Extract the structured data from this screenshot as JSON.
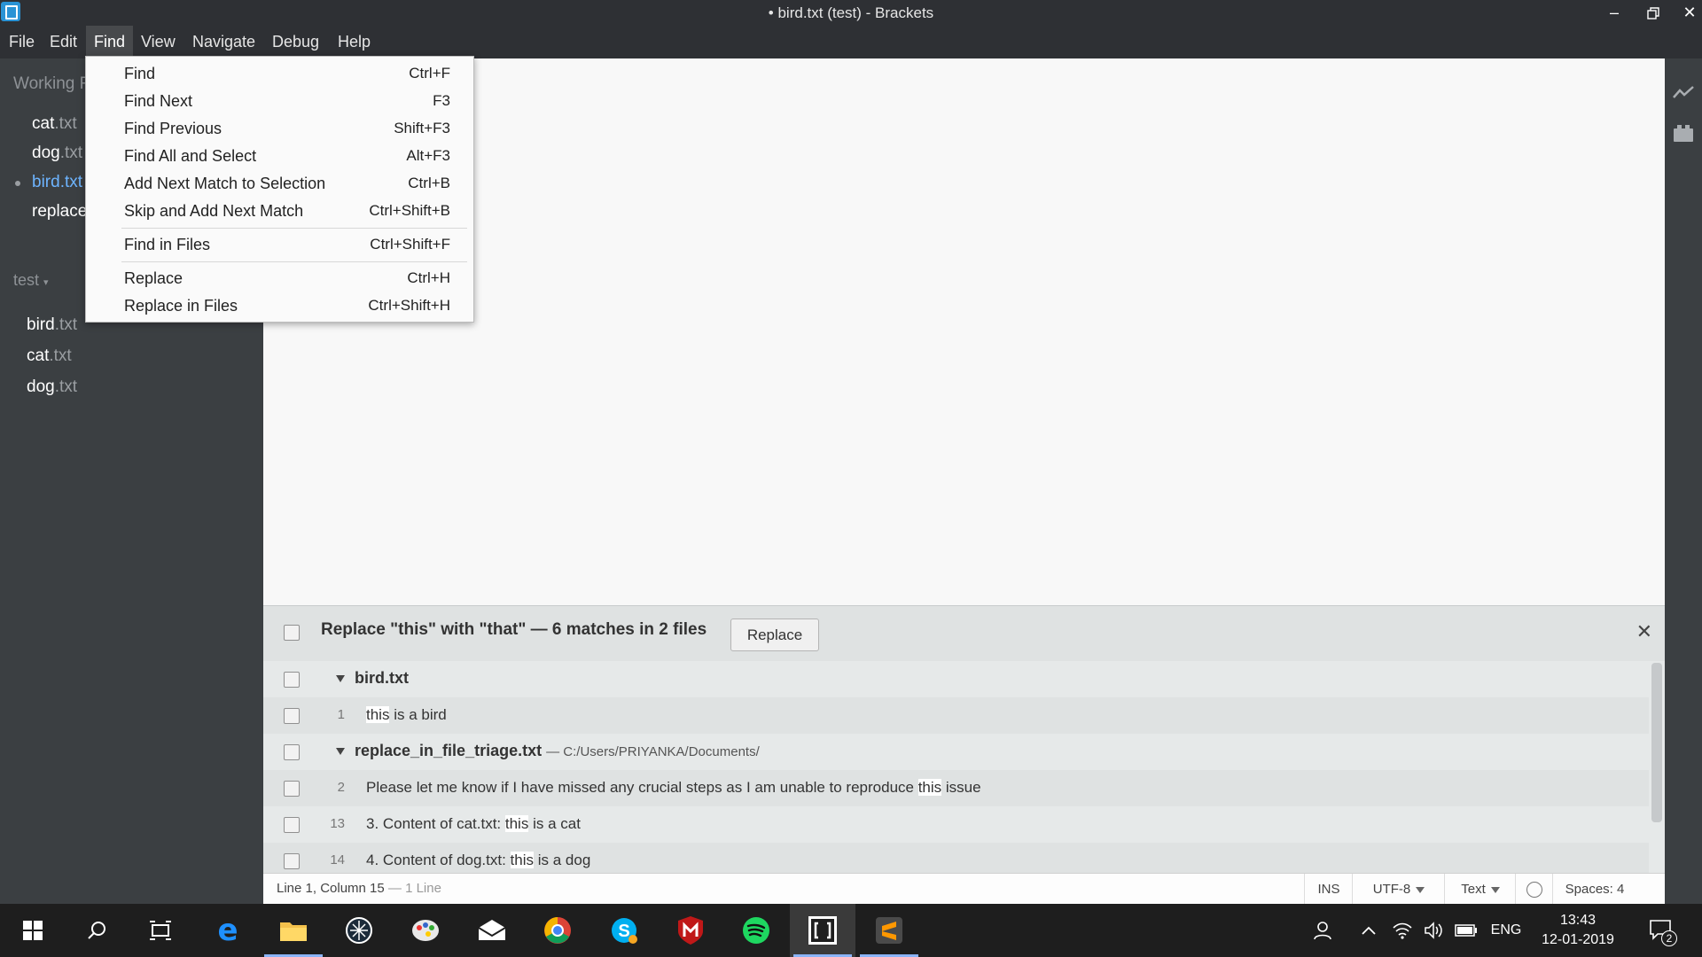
{
  "window": {
    "title": "• bird.txt (test) - Brackets",
    "minimize_icon": "minimize-icon",
    "restore_icon": "restore-icon",
    "close_icon": "close-icon"
  },
  "menubar": [
    "File",
    "Edit",
    "Find",
    "View",
    "Navigate",
    "Debug",
    "Help"
  ],
  "active_menu": "Find",
  "find_menu": {
    "items": [
      {
        "label": "Find",
        "shortcut": "Ctrl+F"
      },
      {
        "label": "Find Next",
        "shortcut": "F3"
      },
      {
        "label": "Find Previous",
        "shortcut": "Shift+F3"
      },
      {
        "label": "Find All and Select",
        "shortcut": "Alt+F3"
      },
      {
        "label": "Add Next Match to Selection",
        "shortcut": "Ctrl+B"
      },
      {
        "label": "Skip and Add Next Match",
        "shortcut": "Ctrl+Shift+B"
      },
      {
        "label": "Find in Files",
        "shortcut": "Ctrl+Shift+F"
      },
      {
        "label": "Replace",
        "shortcut": "Ctrl+H"
      },
      {
        "label": "Replace in Files",
        "shortcut": "Ctrl+Shift+H"
      }
    ]
  },
  "sidebar": {
    "working_files_title": "Working F",
    "working_files": [
      {
        "base": "cat",
        "ext": ".txt"
      },
      {
        "base": "dog",
        "ext": ".txt"
      },
      {
        "base": "bird",
        "ext": ".txt"
      },
      {
        "base": "replace",
        "ext": ""
      }
    ],
    "project_title": "test",
    "project_files": [
      {
        "base": "bird",
        "ext": ".txt"
      },
      {
        "base": "cat",
        "ext": ".txt"
      },
      {
        "base": "dog",
        "ext": ".txt"
      }
    ]
  },
  "search_panel": {
    "title": "Replace \"this\" with \"that\" — 6 matches in 2 files",
    "replace_button": "Replace",
    "close_icon": "close-icon",
    "files": [
      {
        "name": "bird.txt",
        "path": "",
        "matches": [
          {
            "line": "1",
            "pre": "",
            "hit": "this",
            "post": " is a bird"
          }
        ]
      },
      {
        "name": "replace_in_file_triage.txt",
        "path": "— C:/Users/PRIYANKA/Documents/",
        "matches": [
          {
            "line": "2",
            "pre": "Please let me know if I have missed any crucial steps as I am unable to reproduce ",
            "hit": "this",
            "post": " issue"
          },
          {
            "line": "13",
            "pre": "3. Content of cat.txt: ",
            "hit": "this",
            "post": " is a cat"
          },
          {
            "line": "14",
            "pre": "4. Content of dog.txt: ",
            "hit": "this",
            "post": " is a dog"
          }
        ]
      }
    ]
  },
  "statusbar": {
    "position": "Line 1, Column 15",
    "lines": " — 1 Line",
    "mode": "INS",
    "encoding": "UTF-8",
    "language": "Text",
    "spaces": "Spaces: 4"
  },
  "taskbar": {
    "apps": [
      "start-icon",
      "search-icon",
      "task-view-icon",
      "edge-icon",
      "file-explorer-icon",
      "app-icon",
      "paint-icon",
      "mail-icon",
      "chrome-icon",
      "skype-icon",
      "mcafee-icon",
      "spotify-icon",
      "brackets-icon",
      "sublime-icon"
    ],
    "active_app": "brackets-icon",
    "language": "ENG",
    "time": "13:43",
    "date": "12-01-2019",
    "notifications": "2"
  },
  "colors": {
    "accent": "#6db4ff",
    "sidebar_bg": "#3b3f42",
    "editor_bg": "#f8f8f8",
    "panel_bg": "#dfe2e2"
  }
}
